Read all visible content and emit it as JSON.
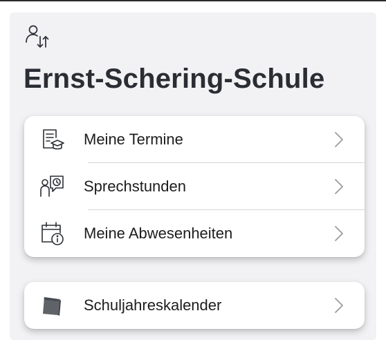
{
  "header": {
    "switch_user_icon": "person-swap-icon",
    "school_name": "Ernst-Schering-Schule"
  },
  "menu": {
    "items": [
      {
        "label": "Meine Termine",
        "icon": "document-graduation-cap-icon"
      },
      {
        "label": "Sprechstunden",
        "icon": "person-clock-icon"
      },
      {
        "label": "Meine Abwesenheiten",
        "icon": "calendar-info-icon"
      }
    ]
  },
  "calendar_menu": {
    "items": [
      {
        "label": "Schuljahreskalender",
        "icon": "calendar-book-icon"
      }
    ]
  },
  "colors": {
    "background": "#f2f2f4",
    "card": "#ffffff",
    "text": "#1c1c1e",
    "title": "#2a2d33",
    "chevron": "#9a9aa0",
    "divider": "#d6d6da"
  }
}
